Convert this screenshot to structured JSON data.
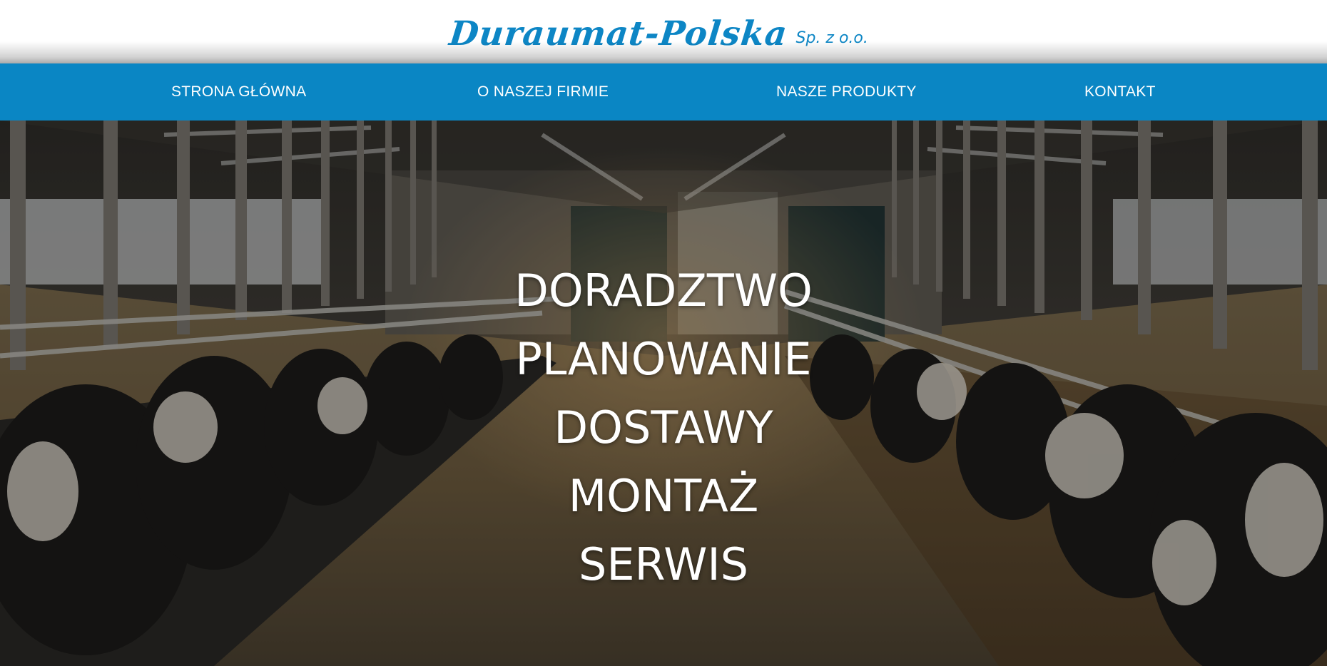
{
  "header": {
    "logo_main": "Duraumat-Polska",
    "logo_sub": "Sp. z o.o."
  },
  "nav": {
    "items": [
      {
        "label": "STRONA GŁÓWNA"
      },
      {
        "label": "O NASZEJ FIRMIE"
      },
      {
        "label": "NASZE PRODUKTY"
      },
      {
        "label": "KONTAKT"
      }
    ]
  },
  "hero": {
    "image": "cow-barn-photo",
    "services": [
      "DORADZTWO",
      "PLANOWANIE",
      "DOSTAWY",
      "MONTAŻ",
      "SERWIS"
    ]
  },
  "colors": {
    "brand": "#0a86c4",
    "logo": "#0d86c5",
    "nav_text": "#ffffff",
    "hero_text": "#ffffff"
  }
}
